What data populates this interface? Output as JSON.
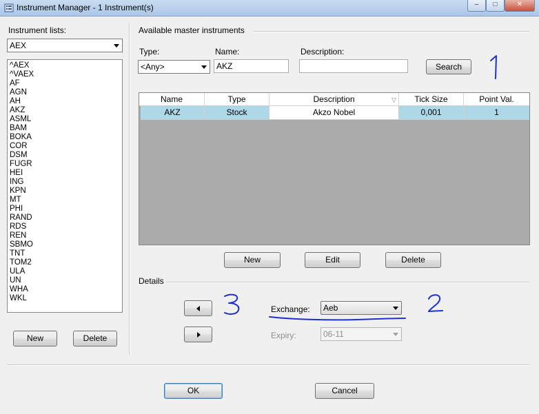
{
  "window": {
    "title": "Instrument Manager - 1 Instrument(s)",
    "min_glyph": "–",
    "max_glyph": "□",
    "close_glyph": "✕"
  },
  "left": {
    "lists_label": "Instrument lists:",
    "selected_list": "AEX",
    "instruments": [
      "^AEX",
      "^VAEX",
      "AF",
      "AGN",
      "AH",
      "AKZ",
      "ASML",
      "BAM",
      "BOKA",
      "COR",
      "DSM",
      "FUGR",
      "HEI",
      "ING",
      "KPN",
      "MT",
      "PHI",
      "RAND",
      "RDS",
      "REN",
      "SBMO",
      "TNT",
      "TOM2",
      "ULA",
      "UN",
      "WHA",
      "WKL"
    ],
    "new_label": "New",
    "delete_label": "Delete"
  },
  "master": {
    "group_label": "Available master instruments",
    "type_label": "Type:",
    "type_value": "<Any>",
    "name_label": "Name:",
    "name_value": "AKZ",
    "desc_label": "Description:",
    "desc_value": "",
    "search_label": "Search"
  },
  "grid": {
    "columns": [
      "Name",
      "Type",
      "Description",
      "Tick Size",
      "Point Val."
    ],
    "sort_glyph": "▽",
    "rows": [
      {
        "name": "AKZ",
        "type": "Stock",
        "description": "Akzo Nobel",
        "tick_size": "0,001",
        "point_val": "1"
      }
    ]
  },
  "actions": {
    "new_label": "New",
    "edit_label": "Edit",
    "delete_label": "Delete"
  },
  "details": {
    "group_label": "Details",
    "exchange_label": "Exchange:",
    "exchange_value": "Aeb",
    "expiry_label": "Expiry:",
    "expiry_value": "06-11"
  },
  "footer": {
    "ok_label": "OK",
    "cancel_label": "Cancel"
  },
  "annotations": {
    "note1": "1",
    "note2": "2",
    "note3": "3",
    "ink_color": "#1a2fd8"
  },
  "colors": {
    "selection": "#add8e6",
    "grid_background": "#ababab",
    "dialog": "#f0f0f0"
  }
}
